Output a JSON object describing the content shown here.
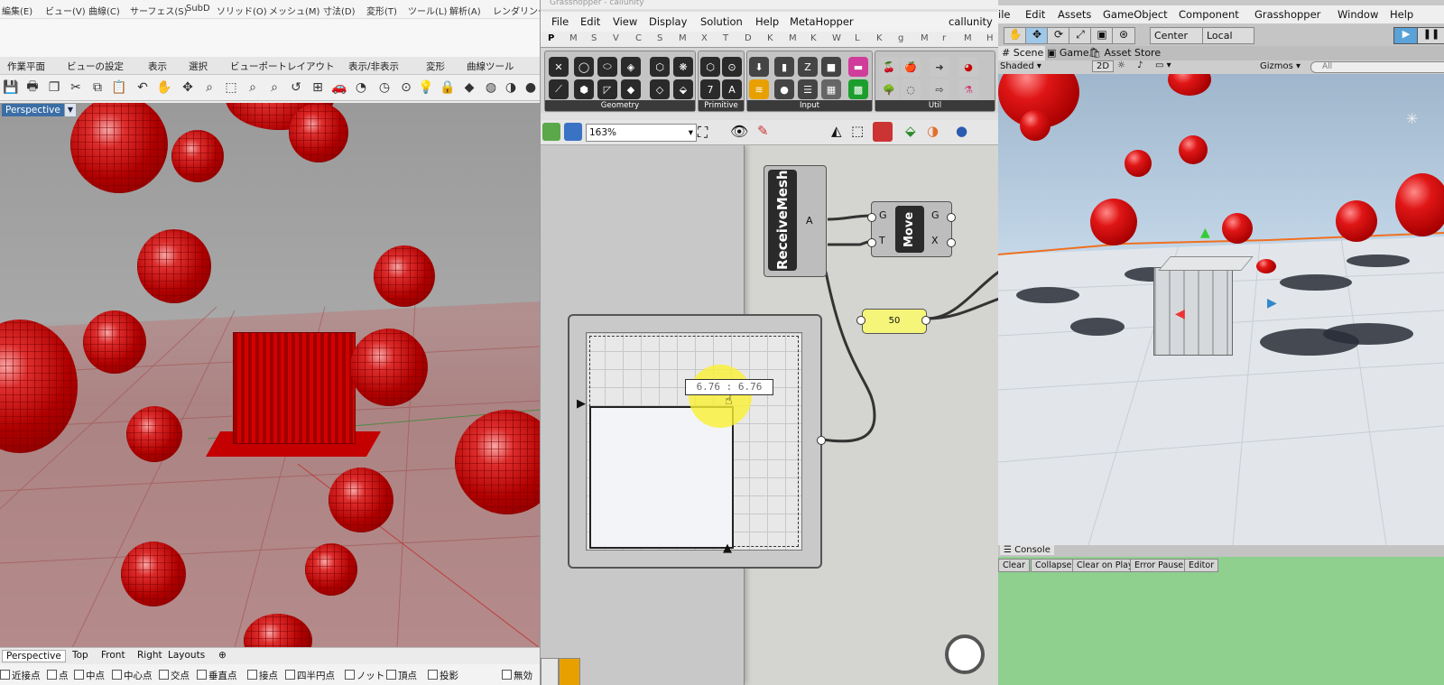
{
  "rhino": {
    "menus": [
      "編集(E)",
      "ビュー(V)",
      "曲線(C)",
      "サーフェス(S)",
      "SubD",
      "ソリッド(O)",
      "メッシュ(M)",
      "寸法(D)",
      "変形(T)",
      "ツール(L)",
      "解析(A)",
      "レンダリング(…"
    ],
    "tabs": [
      "作業平面",
      "ビューの設定",
      "表示",
      "選択",
      "ビューポートレイアウト",
      "表示/非表示",
      "変形",
      "曲線ツール"
    ],
    "viewport_label": "Perspective",
    "bottom_tabs": [
      "Perspective",
      "Top",
      "Front",
      "Right",
      "Layouts"
    ],
    "osnaps": [
      "近接点",
      "点",
      "中点",
      "中心点",
      "交点",
      "垂直点",
      "接点",
      "四半円点",
      "ノット",
      "頂点",
      "投影"
    ],
    "disable_label": "無効"
  },
  "grasshopper": {
    "title": "Grasshopper - callunity",
    "menus": [
      "File",
      "Edit",
      "View",
      "Display",
      "Solution",
      "Help",
      "MetaHopper"
    ],
    "doc_name": "callunity",
    "tab_letters": [
      "P",
      "M",
      "S",
      "V",
      "C",
      "S",
      "M",
      "X",
      "T",
      "D",
      "K",
      "M",
      "K",
      "W",
      "L",
      "K",
      "g",
      "M",
      "r",
      "M",
      "H"
    ],
    "groups": [
      "Geometry",
      "Primitive",
      "Input",
      "Util"
    ],
    "zoom": "163%",
    "receive_label": "ReceiveMesh",
    "receive_output": "A",
    "move_label": "Move",
    "move_inputs": [
      "G",
      "T"
    ],
    "move_outputs": [
      "G",
      "X"
    ],
    "slider_value": "50",
    "mdslider_readout": "6.76 : 6.76"
  },
  "unity": {
    "menus": [
      "ile",
      "Edit",
      "Assets",
      "GameObject",
      "Component",
      "Grasshopper",
      "Window",
      "Help"
    ],
    "pivot_center": "Center",
    "pivot_local": "Local",
    "tabs": [
      "Scene",
      "Game",
      "Asset Store"
    ],
    "shading": "Shaded",
    "mode_2d": "2D",
    "gizmos": "Gizmos",
    "search_placeholder": "All",
    "console_tab": "Console",
    "console_buttons": [
      "Clear",
      "Collapse",
      "Clear on Play",
      "Error Pause",
      "Editor"
    ]
  }
}
